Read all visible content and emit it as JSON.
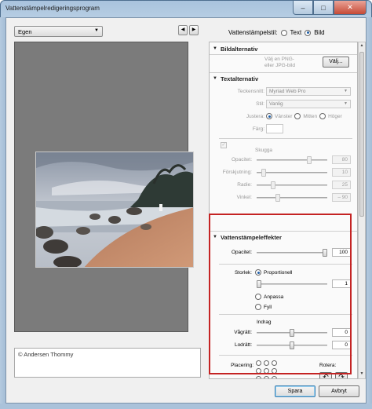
{
  "window": {
    "title": "Vattenstämpelredigeringsprogram",
    "minimize": "–",
    "maximize": "□",
    "close": "✕"
  },
  "toolbar": {
    "preset_value": "Egen",
    "prev": "◀",
    "next": "▶"
  },
  "watermark_style": {
    "label": "Vattenstämpelstil:",
    "options": [
      "Text",
      "Bild"
    ],
    "selected": "Bild"
  },
  "copyright_text": "© Andersen Thommy",
  "image_options": {
    "header": "Bildalternativ",
    "hint_line1": "Välj en PNG-",
    "hint_line2": "eller JPG-bild",
    "choose_button": "Välj..."
  },
  "text_options": {
    "header": "Textalternativ",
    "font_label": "Teckensnitt:",
    "font_value": "Myriad Web Pro",
    "style_label": "Stil:",
    "style_value": "Vanlig",
    "align_label": "Justera:",
    "align_options": [
      "Vänster",
      "Mitten",
      "Höger"
    ],
    "align_selected": "Vänster",
    "color_label": "Färg:"
  },
  "shadow": {
    "label": "Skugga",
    "opacity_label": "Opacitet:",
    "opacity_value": "80",
    "offset_label": "Förskjutning:",
    "offset_value": "10",
    "radius_label": "Radie:",
    "radius_value": "25",
    "angle_label": "Vinkel:",
    "angle_value": "– 90"
  },
  "effects": {
    "header": "Vattenstämpeleffekter",
    "opacity_label": "Opacitet:",
    "opacity_value": "100",
    "size_label": "Storlek:",
    "size_options": [
      "Proportionell",
      "Anpassa",
      "Fyll"
    ],
    "size_selected": "Proportionell",
    "size_value": "1",
    "inset_label": "Indrag",
    "horizontal_label": "Vågrätt:",
    "horizontal_value": "0",
    "vertical_label": "Lodrätt:",
    "vertical_value": "0",
    "placement_label": "Placering:",
    "rotate_label": "Rotera:",
    "rotate_left": "↶",
    "rotate_right": "↷"
  },
  "footer": {
    "save": "Spara",
    "cancel": "Avbryt"
  },
  "colors": {
    "highlight_border": "#c42323",
    "preview_bg": "#7b7b7b"
  }
}
